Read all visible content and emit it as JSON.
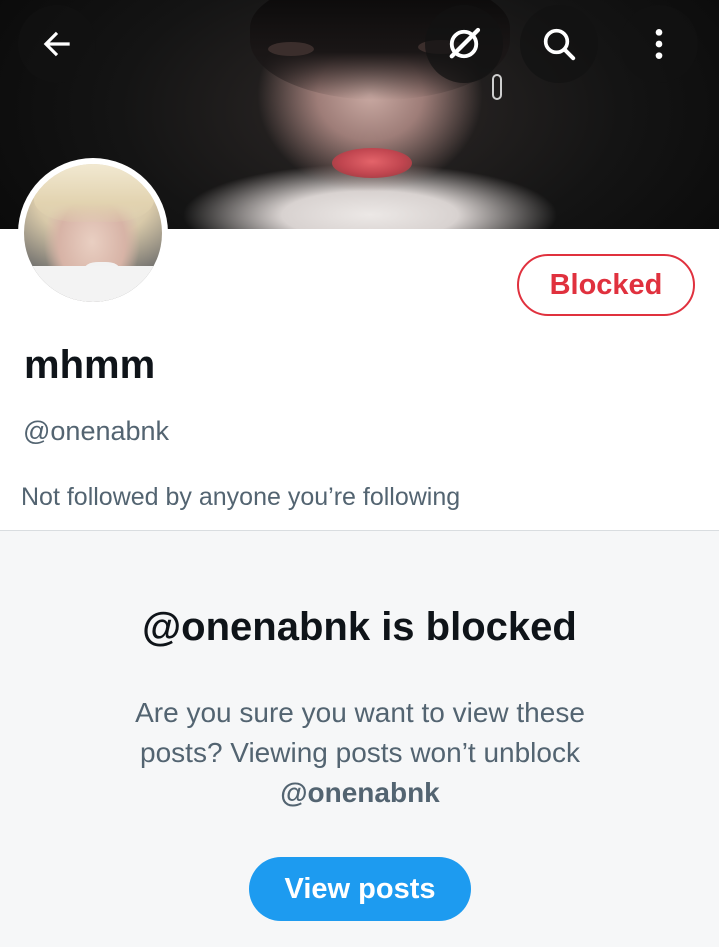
{
  "header": {
    "back_icon": "arrow-left-icon",
    "grok_icon": "grok-icon",
    "search_icon": "search-icon",
    "more_icon": "more-vertical-icon"
  },
  "profile": {
    "display_name": "mhmm",
    "handle": "@onenabnk",
    "blocked_label": "Blocked",
    "followed_by": "Not followed by anyone you’re following"
  },
  "blocked_notice": {
    "title": "@onenabnk is blocked",
    "message": "Are you sure you want to view these posts? Viewing posts won’t unblock",
    "message_handle": "@onenabnk",
    "button_label": "View posts"
  },
  "colors": {
    "accent": "#1d9bf0",
    "blocked_red": "#e0313e",
    "text_primary": "#0f1419",
    "text_secondary": "#536471"
  }
}
